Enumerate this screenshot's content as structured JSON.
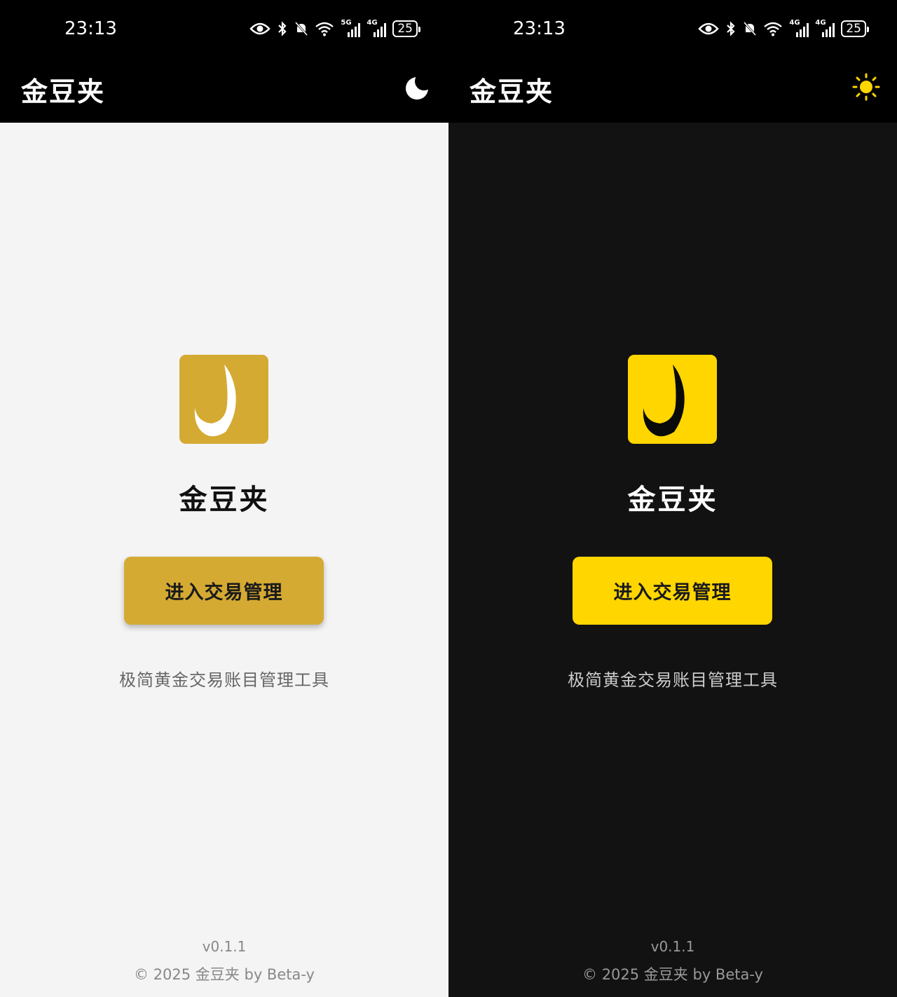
{
  "status_bar": {
    "time": "23:13",
    "battery": "25",
    "signal_1": "5G",
    "signal_2": "4G"
  },
  "light_panel": {
    "app_title": "金豆夹",
    "theme_icon": "moon-icon",
    "brand_name": "金豆夹",
    "enter_button": "进入交易管理",
    "tagline": "极简黄金交易账目管理工具",
    "version": "v0.1.1",
    "copyright": "© 2025 金豆夹 by Beta-y"
  },
  "dark_panel": {
    "app_title": "金豆夹",
    "theme_icon": "sun-icon",
    "brand_name": "金豆夹",
    "enter_button": "进入交易管理",
    "tagline": "极简黄金交易账目管理工具",
    "version": "v0.1.1",
    "copyright": "© 2025 金豆夹 by Beta-y"
  },
  "colors": {
    "light_accent": "#d4aa33",
    "dark_accent": "#ffd600",
    "light_bg": "#f4f4f4",
    "dark_bg": "#121212",
    "bar_bg": "#000000"
  }
}
